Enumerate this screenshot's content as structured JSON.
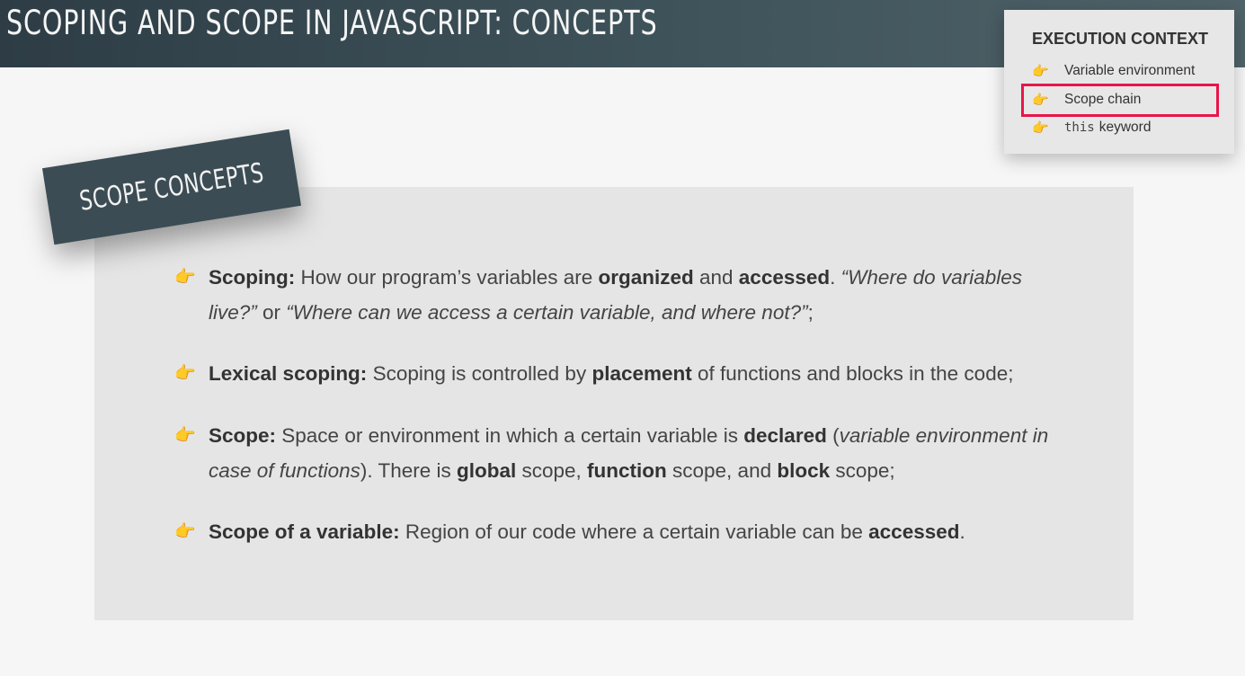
{
  "header": {
    "title": "SCOPING AND SCOPE IN JAVASCRIPT: CONCEPTS"
  },
  "execution_context": {
    "title": "EXECUTION CONTEXT",
    "items": [
      {
        "code": "",
        "label": "Variable environment"
      },
      {
        "code": "",
        "label": "Scope chain",
        "highlighted": true
      },
      {
        "code": "this",
        "label": "keyword"
      }
    ],
    "highlight_color": "#e8154a"
  },
  "section_label": "SCOPE CONCEPTS",
  "bullet_icon": "pointing-hand-icon",
  "bullets": [
    {
      "p1_bold": "Scoping:",
      "p2": " How our program’s variables are ",
      "p3_bold": "organized",
      "p4": " and ",
      "p5_bold": "accessed",
      "p6": ". ",
      "p7_italic": "“Where do variables live?”",
      "p8": " or ",
      "p9_italic": "“Where can we access a certain variable, and where not?”",
      "p10": ";"
    },
    {
      "p1_bold": "Lexical scoping:",
      "p2": " Scoping is controlled by ",
      "p3_bold": "placement",
      "p4": " of functions and blocks in the code;"
    },
    {
      "p1_bold": "Scope:",
      "p2": " Space or environment in which a certain variable is ",
      "p3_bold": "declared",
      "p4": " (",
      "p5_italic": "variable environment in case of functions",
      "p6": "). There is ",
      "p7_bold": "global",
      "p8": " scope, ",
      "p9_bold": "function",
      "p10": " scope, and ",
      "p11_bold": "block",
      "p12": " scope;"
    },
    {
      "p1_bold": "Scope of a variable:",
      "p2": " Region of our code where a certain variable can be ",
      "p3_bold": "accessed",
      "p4": "."
    }
  ],
  "colors": {
    "header": "#3f535b",
    "accent_hand": "#f0a81c",
    "panel": "#e5e5e5"
  }
}
